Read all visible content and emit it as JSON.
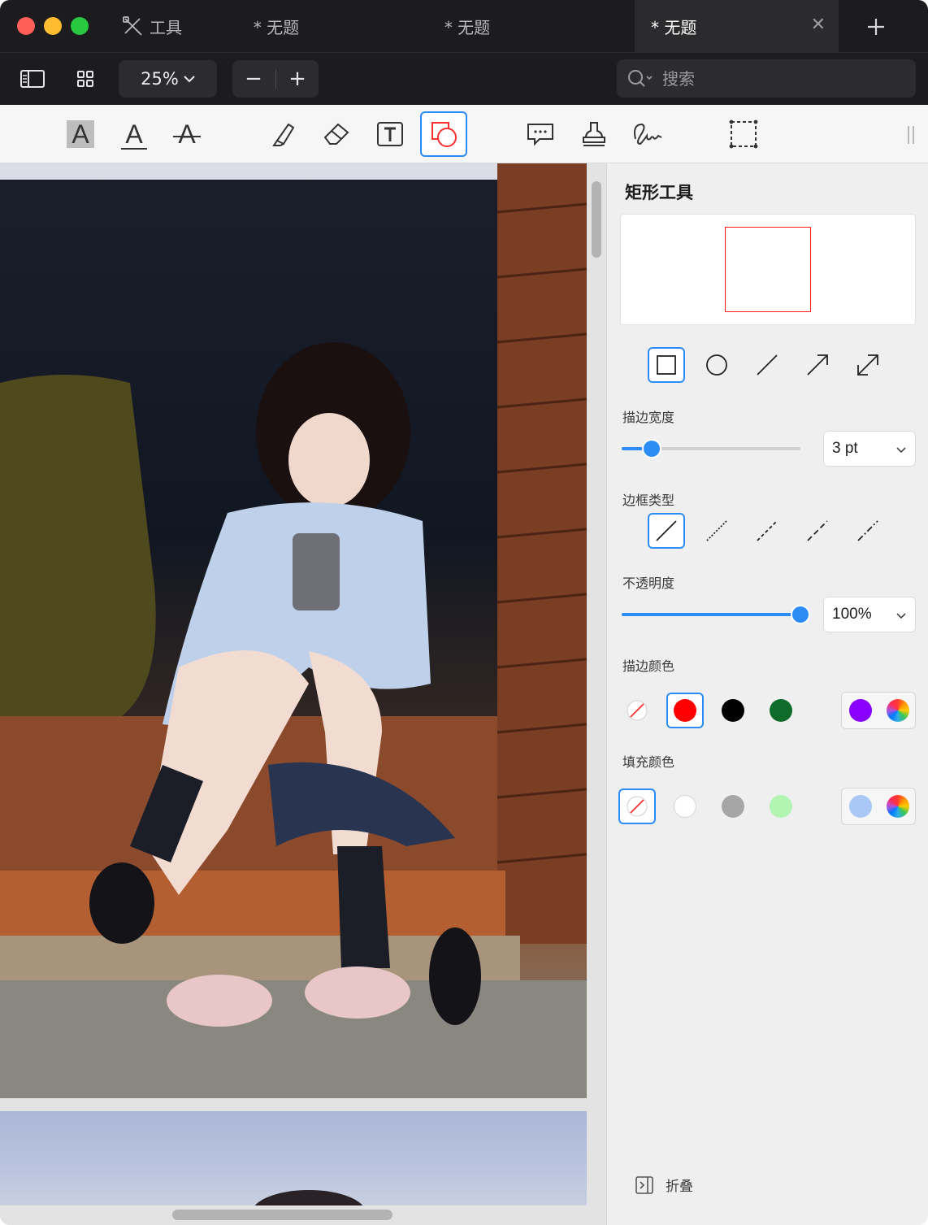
{
  "window": {
    "tabs": [
      {
        "label": "工具"
      },
      {
        "label": "* 无题"
      },
      {
        "label": "* 无题"
      },
      {
        "label": "* 无题"
      }
    ]
  },
  "toolbar": {
    "zoom": "25%",
    "zoom_out": "−",
    "zoom_in": "+",
    "search_placeholder": "搜索"
  },
  "annotation_tools": [
    {
      "icon": "highlight-text-icon",
      "letter": "A"
    },
    {
      "icon": "underline-text-icon",
      "letter": "A"
    },
    {
      "icon": "strikethrough-text-icon",
      "letter": "A"
    },
    {
      "icon": "highlighter-pen-icon"
    },
    {
      "icon": "eraser-icon"
    },
    {
      "icon": "text-box-icon"
    },
    {
      "icon": "shapes-icon",
      "selected": true
    },
    {
      "icon": "comment-icon"
    },
    {
      "icon": "stamp-icon"
    },
    {
      "icon": "signature-icon"
    },
    {
      "icon": "rectangle-select-icon"
    }
  ],
  "panel": {
    "title": "矩形工具",
    "preview_stroke_color": "#ff1a1a",
    "shapes": [
      "rectangle-icon",
      "circle-icon",
      "line-icon",
      "arrow-icon",
      "double-arrow-icon"
    ],
    "selected_shape": "rectangle-icon",
    "stroke_width": {
      "label": "描边宽度",
      "value": "3 pt",
      "level": 0.17
    },
    "border_type": {
      "label": "边框类型",
      "options": [
        "solid",
        "dotted",
        "dashed",
        "long-dash",
        "dash-dot"
      ],
      "selected": "solid"
    },
    "opacity": {
      "label": "不透明度",
      "value": "100%",
      "level": 1.0
    },
    "stroke_color": {
      "label": "描边颜色",
      "swatches": [
        "none",
        "#ff0000",
        "#000000",
        "#0f6b2a"
      ],
      "selected": "#ff0000",
      "custom": "#8a00ff"
    },
    "fill_color": {
      "label": "填充颜色",
      "swatches": [
        "none",
        "#ffffff",
        "#a6a6a6",
        "#b2f5b2"
      ],
      "selected": "none",
      "custom": "#a9c8f5"
    },
    "collapse_label": "折叠"
  },
  "colors": {
    "accent": "#2b8cf5",
    "titlebar": "#1c1c1e"
  }
}
